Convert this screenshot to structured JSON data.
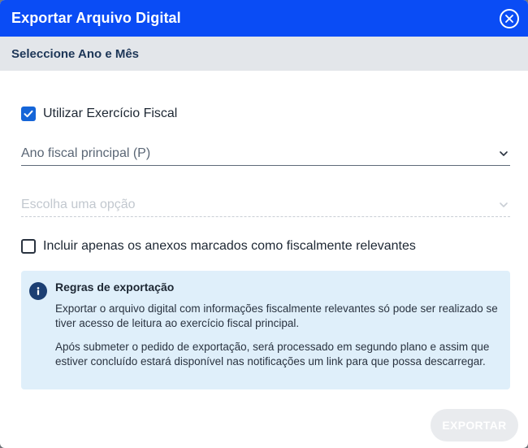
{
  "dialog": {
    "title": "Exportar Arquivo Digital",
    "close_icon": "close-circle-icon",
    "subtitle": "Seleccione Ano e Mês"
  },
  "form": {
    "use_fiscal_year": {
      "label": "Utilizar Exercício Fiscal",
      "checked": true
    },
    "fiscal_year_select": {
      "value": "Ano fiscal principal (P)",
      "disabled": false
    },
    "option_select": {
      "placeholder": "Escolha uma opção",
      "disabled": true
    },
    "only_relevant": {
      "label": "Incluir apenas os anexos marcados como fiscalmente relevantes",
      "checked": false
    }
  },
  "info_box": {
    "icon": "info-icon",
    "title": "Regras de exportação",
    "paragraph1": "Exportar o arquivo digital com informações fiscalmente relevantes só pode ser realizado se tiver acesso de leitura ao exercício fiscal principal.",
    "paragraph2": "Após submeter o pedido de exportação, será processado em segundo plano e assim que estiver concluído estará disponível nas notificações um link para que possa descarregar."
  },
  "actions": {
    "export_label": "EXPORTAR",
    "export_disabled": true
  },
  "colors": {
    "header": "#0a4cf5",
    "subheader": "#e3e6ea",
    "checkbox": "#1565d8",
    "info_bg": "#dfeffa",
    "info_icon": "#1c3f73",
    "button_disabled": "#e9ebee"
  }
}
